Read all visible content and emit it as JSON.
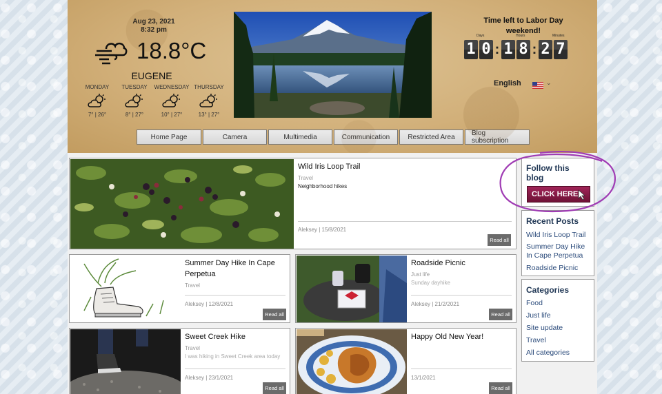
{
  "header": {
    "date": "Aug 23, 2021",
    "time": "8:32 pm",
    "temperature": "18.8°C",
    "city": "EUGENE",
    "forecast": [
      {
        "day": "MONDAY",
        "range": "7° | 26°",
        "icon": "partly-cloudy-icon"
      },
      {
        "day": "TUESDAY",
        "range": "8° | 27°",
        "icon": "partly-cloudy-icon"
      },
      {
        "day": "WEDNESDAY",
        "range": "10° | 27°",
        "icon": "partly-cloudy-icon"
      },
      {
        "day": "THURSDAY",
        "range": "13° | 27°",
        "icon": "partly-cloudy-icon"
      }
    ],
    "countdown": {
      "title": "Time left to Labor Day weekend!",
      "labels": {
        "days": "Days",
        "hours": "Hours",
        "minutes": "Minutes"
      },
      "days": [
        "1",
        "0"
      ],
      "hours": [
        "1",
        "8"
      ],
      "minutes": [
        "2",
        "7"
      ]
    },
    "language": "English",
    "flag_icon": "us-flag-icon"
  },
  "nav": [
    "Home Page",
    "Camera",
    "Multimedia",
    "Communication",
    "Restricted Area",
    "Blog subscription"
  ],
  "posts": {
    "featured": {
      "title": "Wild Iris Loop Trail",
      "category": "Travel",
      "description": "Neighborhood hikes",
      "meta": "Aleksey | 15/8/2021",
      "read": "Read all"
    },
    "grid": [
      {
        "title": "Summer Day Hike In Cape Perpetua",
        "category": "Travel",
        "description": "",
        "meta": "Aleksey | 12/8/2021",
        "read": "Read all"
      },
      {
        "title": "Roadside Picnic",
        "category": "Just life",
        "description": "Sunday dayhike",
        "meta": "Aleksey | 21/2/2021",
        "read": "Read all"
      },
      {
        "title": "Sweet Creek Hike",
        "category": "Travel",
        "description": "I was hiking in Sweet Creek area today",
        "meta": "Aleksey | 23/1/2021",
        "read": "Read all"
      },
      {
        "title": "Happy Old New Year!",
        "category": "",
        "description": "",
        "meta": "13/1/2021",
        "read": "Read all"
      }
    ]
  },
  "sidebar": {
    "follow": {
      "title": "Follow this blog",
      "button": "CLICK HERE"
    },
    "recent": {
      "title": "Recent Posts",
      "items": [
        "Wild Iris Loop Trail",
        "Summer Day Hike In Cape Perpetua",
        "Roadside Picnic"
      ]
    },
    "categories": {
      "title": "Categories",
      "items": [
        "Food",
        "Just life",
        "Site update",
        "Travel",
        "All categories"
      ]
    }
  },
  "colors": {
    "accent_nav": "#d8d8d8",
    "sidebar_heading": "#1f3654",
    "link": "#2a4a7a",
    "cta": "#8b1a4a",
    "annotation": "#a03cb4"
  }
}
